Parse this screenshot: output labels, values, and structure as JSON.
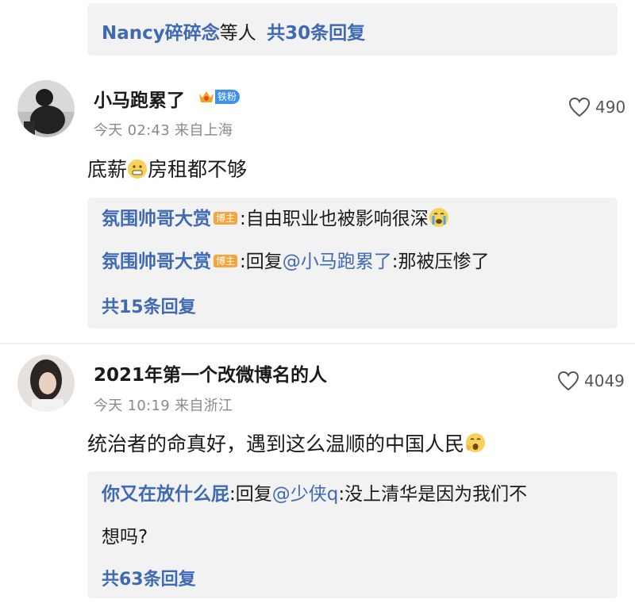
{
  "thread_top": {
    "reply_summary_names": "Nancy碎碎念",
    "reply_summary_suffix": "等人",
    "reply_summary_count": "共30条回复"
  },
  "comments": [
    {
      "username": "小马跑累了",
      "badge": "铁粉",
      "time": "今天 02:43",
      "location": "来自上海",
      "text_before": "底薪",
      "text_after": "房租都不够",
      "likes": "490",
      "replies": [
        {
          "name": "氛围帅哥大赏",
          "tag": "博主",
          "text": ":自由职业也被影响很深"
        },
        {
          "name": "氛围帅哥大赏",
          "tag": "博主",
          "text_before": ":回复",
          "mention": "@小马跑累了",
          "text_after": ":那被压惨了"
        }
      ],
      "total_replies": "共15条回复"
    },
    {
      "username": "2021年第一个改微博名的人",
      "time": "今天 10:19",
      "location": "来自浙江",
      "text": "统治者的命真好，遇到这么温顺的中国人民",
      "likes": "4049",
      "replies": [
        {
          "name": "你又在放什么屁",
          "text_before": ":回复",
          "mention": "@少侠q",
          "text_after": ":没上清华是因为我们不",
          "text_line2": "想吗?"
        }
      ],
      "total_replies": "共63条回复"
    }
  ],
  "colors": {
    "link": "#3f6ab3",
    "tag": "#f7a43b",
    "fan_badge": "#3e8ff0",
    "reply_bg": "#f2f2f2"
  }
}
